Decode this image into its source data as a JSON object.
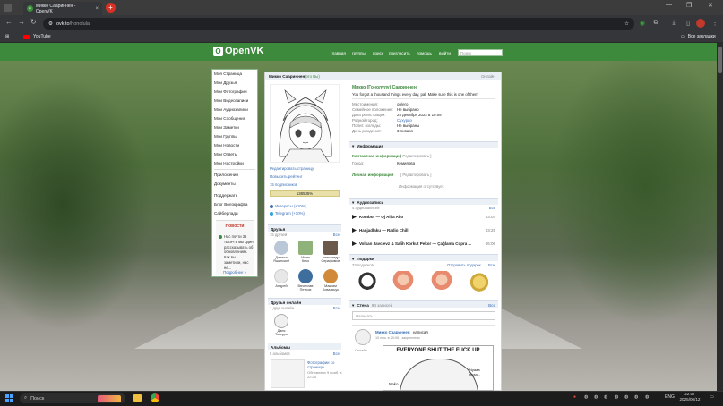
{
  "browser": {
    "tab_title": "Микко Саариннен - OpenVK",
    "tab_icon": "openvk-icon",
    "url_host": "ovk.to",
    "url_path": "/honolula",
    "bookmark": "YouTube",
    "all_bookmarks": "Все закладки"
  },
  "header": {
    "logo": "OpenVK",
    "nav": [
      "главная",
      "группы",
      "поиск",
      "пригласить",
      "помощь",
      "выйти"
    ],
    "search_placeholder": "Поиск"
  },
  "sidebar": {
    "items": [
      "Моя Страница",
      "Мои Друзья",
      "Мои Фотографии",
      "Мои Видеозаписи",
      "Мои Аудиозаписи",
      "Мои Сообщения",
      "Мои Заметки",
      "Мои Группы",
      "Мои Новости",
      "Мои Ответы",
      "Мои Настройки"
    ],
    "items2": [
      "Приложения",
      "Документы"
    ],
    "items3": [
      "Поддержать",
      "Блог Волокрафта",
      "Сайберлади"
    ],
    "news_title": "Новости",
    "news_text": "Нас почти 36 тысяч и мы один рассказывать об обновлениях. Как вы заметили, нас не...",
    "news_more": "Подробнее »"
  },
  "profile": {
    "header_name": "Микко Саариннен",
    "header_status": "(это Вы)",
    "online": "Онлайн",
    "full_name": "Микко (Гонолулу) Саариннен",
    "status_text": "You forgot a thousand things every day, pal. Make sure this is one of them",
    "edit_page": "Редактировать страницу",
    "raise_rating": "Повысить рейтинг",
    "subscribers": "15 подписчиков",
    "rating": "138535%",
    "links": [
      "Интересы (+10%)",
      "Telegram (+10%)"
    ],
    "fields": [
      [
        "Местоимения:",
        "он/его"
      ],
      [
        "Семейное положение:",
        "Не выбрано"
      ],
      [
        "Дата регистрации:",
        "25 декабря 2022 в 10:09"
      ],
      [
        "Родной город:",
        "Сухуриэ"
      ],
      [
        "Полит. взгляды:",
        "Не выбраны"
      ],
      [
        "День рождения:",
        "3 января"
      ]
    ],
    "info_title": "Информация",
    "contacts_title": "Контактная информация",
    "edit_link": "[ Редактировать ]",
    "city_key": "Город:",
    "city_val": "Кемиярва",
    "personal_title": "Личная информация",
    "personal_empty": "Информация отсутствует."
  },
  "friends": {
    "title": "Друзья",
    "count": "15 друзей",
    "all": "Все",
    "list": [
      [
        "Даниил",
        "Яшинский"
      ],
      [
        "Миня",
        "Кеко"
      ],
      [
        "Александр",
        "Серафимов"
      ],
      [
        "Андрей",
        ""
      ],
      [
        "Вячеслав",
        "Петров"
      ],
      [
        "Максим",
        "Ковальчук"
      ]
    ]
  },
  "online_friends": {
    "title": "Друзья онлайн",
    "count": "1 друг онлайн",
    "all": "Все",
    "list": [
      [
        "Даня",
        "Токсуро"
      ]
    ]
  },
  "albums": {
    "title": "Альбомы",
    "count": "5 альбомов",
    "all": "Все",
    "item_title": "Фотографии со страницы",
    "item_sub": "Обновлено 9 нояб. в 22:25"
  },
  "audio": {
    "title": "Аудиозаписи",
    "count": "4 аудиозаписей",
    "all": "Все",
    "tracks": [
      [
        "Kombor — Oj Alija Aljo",
        "03:04"
      ],
      [
        "Hanjadlaku — Radio Chill",
        "03:25"
      ],
      [
        "Volkan Javcievz & Salih Korkut Pekor — Çağlama Copra ...",
        "06:06"
      ]
    ]
  },
  "gifts": {
    "title": "Подарки",
    "count": "33 подарков",
    "send": "Отправить подарок",
    "all": "Все"
  },
  "wall": {
    "title": "Стена",
    "count": "94 записей",
    "all": "Все",
    "placeholder": "Написать...",
    "post_author": "Микко Саариннен",
    "post_action": "написал",
    "post_time": "10 ноя. в 20:06 , закреплено",
    "post_online": "Онлайн",
    "meme_top": "EVERYONE SHUT THE FUCK UP",
    "meme_l": "Neko",
    "meme_r": "Nyaaa nyaa..."
  },
  "taskbar": {
    "search": "Поиск",
    "lang": "ENG",
    "time": "22:07",
    "date": "2025/06/12"
  },
  "colors": {
    "accent": "#3d8a3d",
    "link": "#3b6fb6"
  }
}
